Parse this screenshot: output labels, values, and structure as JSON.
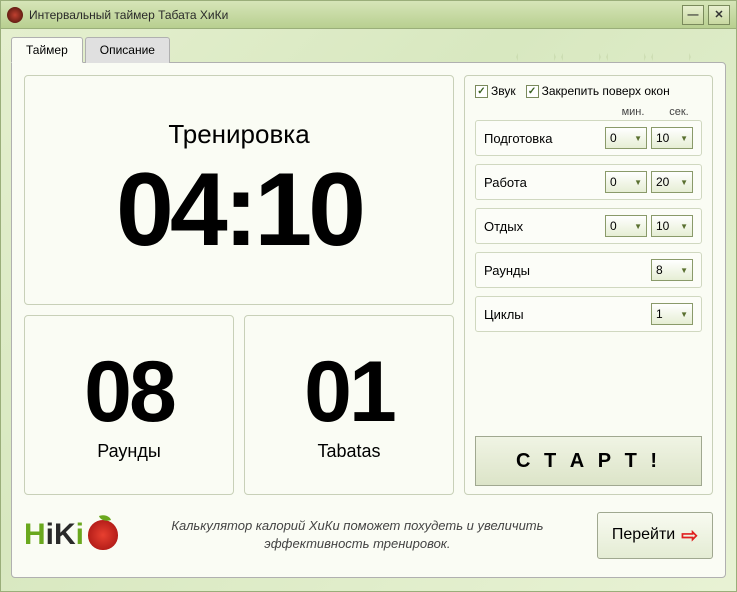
{
  "window": {
    "title": "Интервальный таймер Табата ХиКи"
  },
  "tabs": {
    "timer": "Таймер",
    "description": "Описание"
  },
  "display": {
    "phase": "Тренировка",
    "time": "04:10",
    "rounds_value": "08",
    "rounds_label": "Раунды",
    "tabatas_value": "01",
    "tabatas_label": "Tabatas"
  },
  "options": {
    "sound": "Звук",
    "pin": "Закрепить поверх окон",
    "sound_checked": true,
    "pin_checked": true
  },
  "headers": {
    "min": "мин.",
    "sec": "сек."
  },
  "settings": {
    "prepare": {
      "label": "Подготовка",
      "min": "0",
      "sec": "10"
    },
    "work": {
      "label": "Работа",
      "min": "0",
      "sec": "20"
    },
    "rest": {
      "label": "Отдых",
      "min": "0",
      "sec": "10"
    },
    "rounds": {
      "label": "Раунды",
      "value": "8"
    },
    "cycles": {
      "label": "Циклы",
      "value": "1"
    }
  },
  "buttons": {
    "start": "С Т А Р Т !",
    "goto": "Перейти"
  },
  "footer": {
    "text": "Калькулятор калорий ХиКи поможет похудеть и увеличить эффективность тренировок."
  }
}
